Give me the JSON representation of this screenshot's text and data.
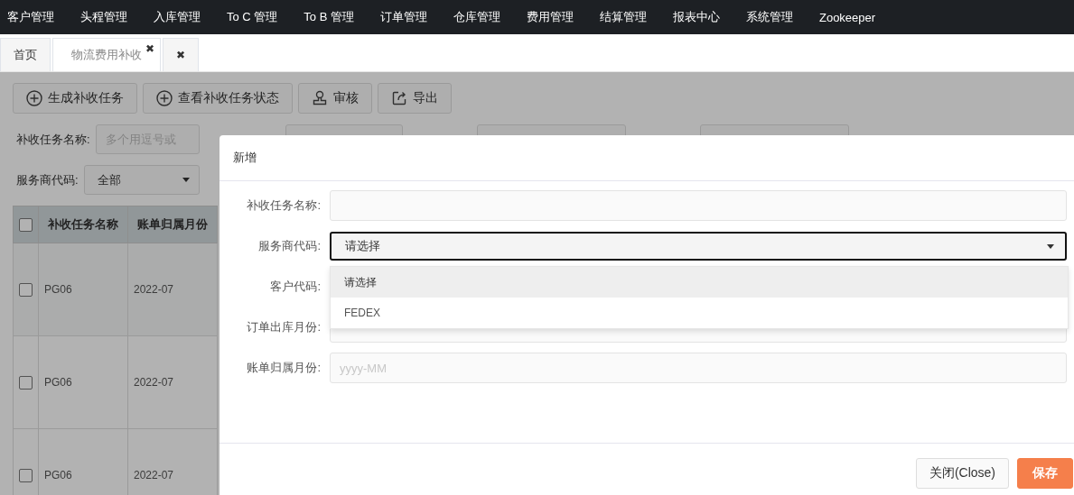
{
  "nav": {
    "items": [
      "客户管理",
      "头程管理",
      "入库管理",
      "To C 管理",
      "To B 管理",
      "订单管理",
      "仓库管理",
      "费用管理",
      "结算管理",
      "报表中心",
      "系统管理",
      "Zookeeper"
    ]
  },
  "tabs": [
    {
      "label": "首页",
      "selected": false
    },
    {
      "label": "物流费用补收",
      "selected": true,
      "close": "✖"
    },
    {
      "close": "✖",
      "selected": false
    }
  ],
  "toolbar": [
    {
      "label": "生成补收任务",
      "kind": "add"
    },
    {
      "label": "查看补收任务状态",
      "kind": "add"
    },
    {
      "label": "审核",
      "kind": "stamp"
    },
    {
      "label": "导出",
      "kind": "export"
    }
  ],
  "filters": [
    [
      {
        "label": "补收任务名称:",
        "kind": "input",
        "placeholder": "多个用逗号或"
      },
      {
        "kind": "select"
      },
      {
        "kind": "input"
      },
      {
        "kind": "input"
      }
    ],
    [
      {
        "label": "服务商代码:",
        "kind": "select",
        "value": "全部"
      }
    ]
  ],
  "table": {
    "columns": [
      "补收任务名称",
      "账单归属月份"
    ],
    "header_checked": false,
    "rows": [
      {
        "checked": false,
        "cells": [
          "PG06",
          "2022-07"
        ]
      },
      {
        "checked": false,
        "cells": [
          "PG06",
          "2022-07"
        ]
      },
      {
        "checked": false,
        "cells": [
          "PG06",
          "2022-07"
        ]
      }
    ]
  },
  "modal": {
    "title": "新增",
    "fields": [
      {
        "label": "补收任务名称:",
        "kind": "text"
      },
      {
        "label": "服务商代码:",
        "kind": "select",
        "value": "请选择",
        "focused": true,
        "options": [
          {
            "label": "请选择",
            "selected": true
          },
          {
            "label": "FEDEX",
            "selected": false
          }
        ]
      },
      {
        "label": "客户代码:",
        "kind": "covered"
      },
      {
        "label": "订单出库月份:",
        "kind": "text"
      },
      {
        "label": "账单归属月份:",
        "kind": "text",
        "placeholder": "yyyy-MM"
      }
    ],
    "buttons": [
      {
        "label": "关闭(Close)",
        "kind": "default"
      },
      {
        "label": "保存",
        "kind": "primary"
      }
    ]
  }
}
